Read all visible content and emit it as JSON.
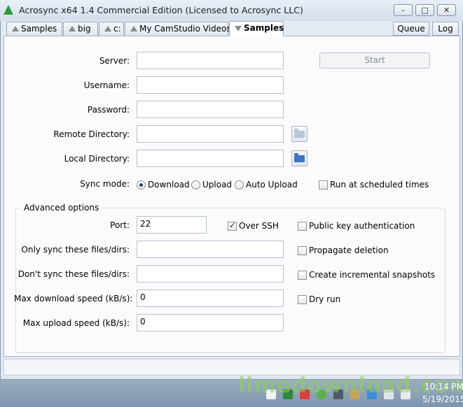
{
  "window": {
    "title": "Acrosync x64 1.4 Commercial Edition (Licensed to Acrosync LLC)",
    "controls": {
      "minimize": "–",
      "maximize": "□",
      "close": "✕"
    }
  },
  "tabs": [
    {
      "label": "Samples",
      "icon": "triangle-up-icon"
    },
    {
      "label": "big",
      "icon": "triangle-up-icon"
    },
    {
      "label": "c:",
      "icon": "triangle-up-icon"
    },
    {
      "label": "My CamStudio Videos",
      "icon": "triangle-up-icon"
    },
    {
      "label": "Samples",
      "icon": "triangle-down-icon",
      "active": true
    }
  ],
  "toolbar": {
    "queue_label": "Queue",
    "log_label": "Log"
  },
  "form": {
    "server": {
      "label": "Server:",
      "value": ""
    },
    "username": {
      "label": "Username:",
      "value": ""
    },
    "password": {
      "label": "Password:",
      "value": ""
    },
    "remote_directory": {
      "label": "Remote Directory:",
      "value": ""
    },
    "local_directory": {
      "label": "Local Directory:",
      "value": ""
    },
    "start_label": "Start",
    "sync_mode": {
      "label": "Sync mode:",
      "options": [
        "Download",
        "Upload",
        "Auto Upload"
      ],
      "selected": "Download"
    },
    "run_scheduled": {
      "label": "Run at scheduled times",
      "checked": false
    }
  },
  "advanced": {
    "title": "Advanced options",
    "port": {
      "label": "Port:",
      "value": "22"
    },
    "over_ssh": {
      "label": "Over SSH",
      "checked": true
    },
    "public_key": {
      "label": "Public key authentication",
      "checked": false
    },
    "only_sync": {
      "label": "Only sync these files/dirs:",
      "value": ""
    },
    "propagate_deletion": {
      "label": "Propagate deletion",
      "checked": false
    },
    "dont_sync": {
      "label": "Don't sync these files/dirs:",
      "value": ""
    },
    "incremental_snapshots": {
      "label": "Create incremental snapshots",
      "checked": false
    },
    "max_download": {
      "label": "Max download speed (kB/s):",
      "value": "0"
    },
    "dry_run": {
      "label": "Dry run",
      "checked": false
    },
    "max_upload": {
      "label": "Max upload speed (kB/s):",
      "value": "0"
    }
  },
  "taskbar": {
    "time": "10:14 PM",
    "date": "5/19/2015"
  },
  "watermark": "limedownload.com",
  "colors": {
    "folder_remote": "#b9c7d8",
    "folder_local": "#3d74c4",
    "app_icon": "#2f9a3c",
    "watermark_green": "#8fd14f"
  }
}
